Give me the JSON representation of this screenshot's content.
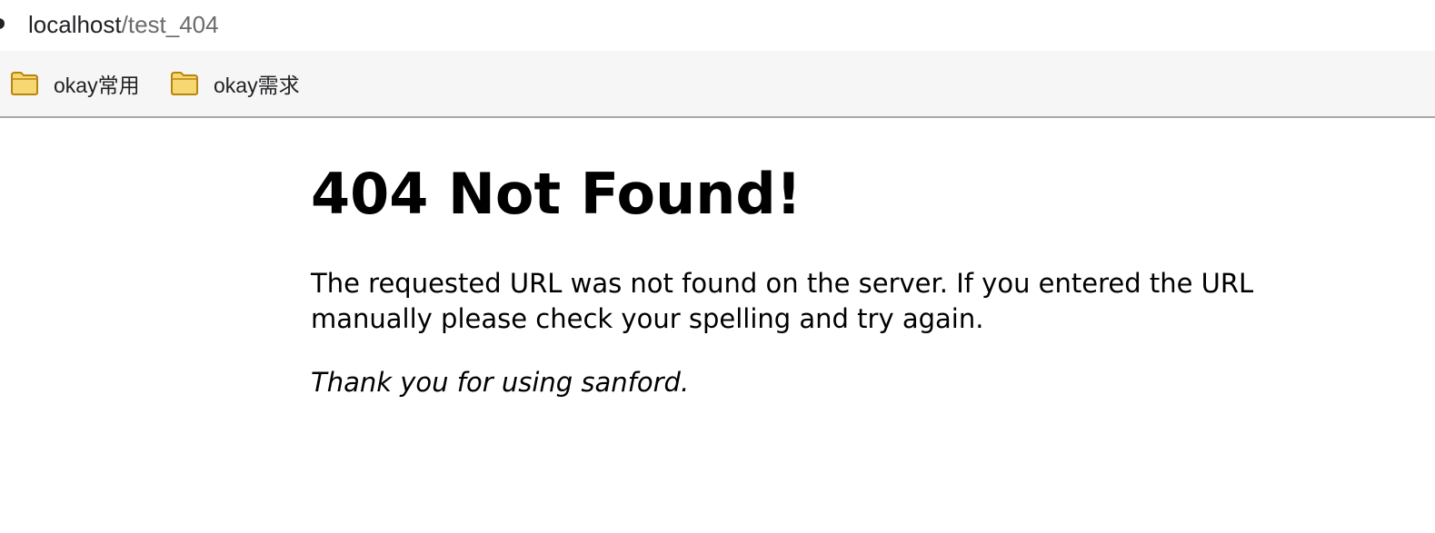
{
  "address_bar": {
    "url_host": "localhost",
    "url_path": "/test_404",
    "site_info_icon": "info-icon"
  },
  "bookmarks_bar": {
    "items": [
      {
        "label": "okay常用",
        "icon": "folder-icon"
      },
      {
        "label": "okay需求",
        "icon": "folder-icon"
      }
    ],
    "folder_fill_color": "#f7d774",
    "folder_stroke_color": "#b8860b"
  },
  "page": {
    "heading": "404 Not Found!",
    "message": "The requested URL was not found on the server. If you entered the URL manually please check your spelling and try again.",
    "thanks": "Thank you for using sanford."
  }
}
